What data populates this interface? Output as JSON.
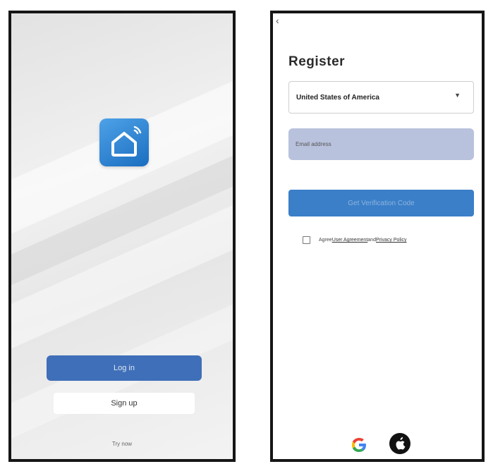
{
  "login_screen": {
    "app_icon": "smart-home-wifi-icon",
    "login_label": "Log in",
    "signup_label": "Sign up",
    "footer_text": "Try now"
  },
  "register_screen": {
    "back_icon": "back-arrow-icon",
    "title": "Register",
    "country": {
      "value": "United States of America",
      "icon": "caret-down-icon"
    },
    "email": {
      "placeholder": "Email address"
    },
    "get_code_label": "Get Verification Code",
    "agreement": {
      "prefix": "Agree",
      "user_agreement": "User Agreement",
      "conjunction": "and",
      "privacy_policy": "Privacy Policy"
    },
    "social": {
      "google_icon": "google-icon",
      "apple_icon": "apple-icon"
    }
  },
  "colors": {
    "primary_blue": "#3f6fb8",
    "code_button_blue": "#3a7fc8",
    "email_field_bg": "#b9c2dd",
    "logo_gradient_start": "#4ea2e8",
    "logo_gradient_end": "#1a6ec0"
  }
}
